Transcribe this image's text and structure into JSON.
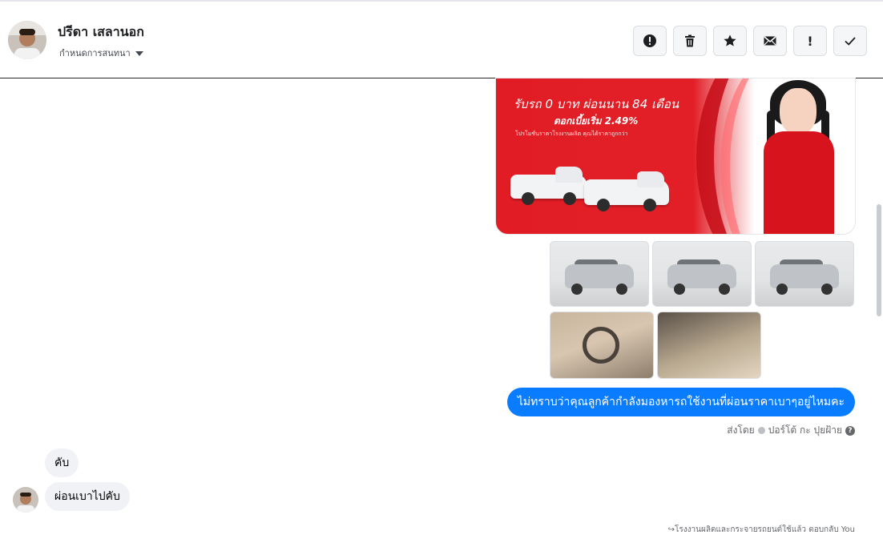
{
  "header": {
    "contact_name": "ปรีดา เสลานอก",
    "assign_label": "กำหนดการสนทนา",
    "actions": [
      {
        "name": "report-button",
        "icon": "alert-circle-icon"
      },
      {
        "name": "delete-button",
        "icon": "trash-icon"
      },
      {
        "name": "star-button",
        "icon": "star-icon"
      },
      {
        "name": "mark-unread-button",
        "icon": "envelope-icon"
      },
      {
        "name": "priority-button",
        "icon": "exclamation-icon",
        "glyph": "!"
      },
      {
        "name": "mark-done-button",
        "icon": "check-icon"
      }
    ]
  },
  "promo": {
    "line_main": "รับรถ 0 บาท ผ่อนนาน 84 เดือน",
    "line_rate": "ดอกเบี้ยเริ่ม 2.49%",
    "line_fine": "โปรโมชั่นราคาโรงงานผลิต คุณได้ราคาถูกกว่า"
  },
  "messages": {
    "outgoing_text": "ไม่ทราบว่าคุณลูกค้ากำลังมองหารถใช้งานที่ผ่อนราคาเบาๆอยู่ไหมคะ",
    "sent_by_label": "ส่งโดย",
    "sent_by_name": "ปอร์โต้ กะ ปุยฝ้าย",
    "incoming_1": "คับ",
    "incoming_2": "ผ่อนเบาไปคับ",
    "footer_note": "โรงงานผลิตและกระจายรถยนต์ใช้แล้ว ตอบกลับ You"
  },
  "colors": {
    "accent": "#0a7cff",
    "promo_red": "#e11c24",
    "incoming_bg": "#f0f2f5"
  }
}
